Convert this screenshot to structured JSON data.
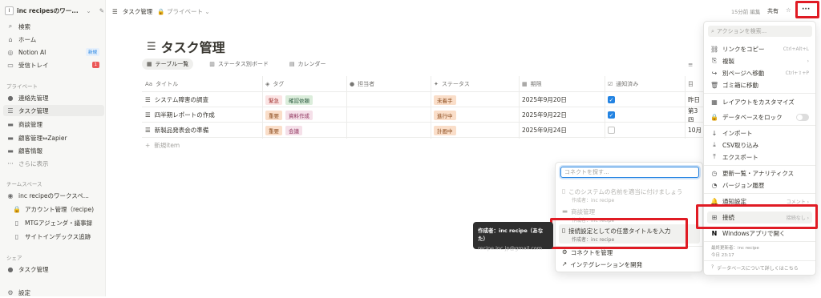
{
  "sidebar": {
    "workspace": "inc recipesのワー...",
    "top_items": [
      {
        "icon": "⌕",
        "label": "検索"
      },
      {
        "icon": "⌂",
        "label": "ホーム"
      },
      {
        "icon": "◎",
        "label": "Notion AI",
        "badge": "新規"
      },
      {
        "icon": "▭",
        "label": "受信トレイ",
        "badge": "1"
      }
    ],
    "private_label": "プライベート",
    "private_items": [
      {
        "label": "連絡先管理"
      },
      {
        "label": "タスク管理"
      },
      {
        "label": "商談管理"
      },
      {
        "label": "顧客管理⇔Zapier"
      },
      {
        "label": "顧客情報"
      },
      {
        "label": "さらに表示"
      }
    ],
    "team_label": "チームスペース",
    "team_items": [
      {
        "label": "inc recipeのワークスペ..."
      },
      {
        "label": "アカウント管理（recipe)"
      },
      {
        "label": "MTGアジェンダ・議事録"
      },
      {
        "label": "サイトインデックス追跡"
      }
    ],
    "share_label": "シェア",
    "share_items": [
      {
        "label": "タスク管理"
      }
    ],
    "settings": "設定"
  },
  "topbar": {
    "breadcrumb": "タスク管理",
    "privacy": "プライベート",
    "edited": "15分前 編集",
    "share": "共有",
    "more": "···"
  },
  "page": {
    "title": "タスク管理",
    "tabs": [
      "テーブル一覧",
      "ステータス別ボード",
      "カレンダー"
    ],
    "columns": [
      "タイトル",
      "タグ",
      "担当者",
      "ステータス",
      "期限",
      "通知済み",
      "目"
    ],
    "rows": [
      {
        "title": "システム障害の調査",
        "tags": [
          "緊急",
          "確認依頼"
        ],
        "status": "未着手",
        "due": "2025年9月20日",
        "done": true,
        "last": "昨日"
      },
      {
        "title": "四半期レポートの作成",
        "tags": [
          "重要",
          "資料作成"
        ],
        "status": "進行中",
        "due": "2025年9月22日",
        "done": true,
        "last": "第3四"
      },
      {
        "title": "新製品発表会の準備",
        "tags": [
          "重要",
          "会議"
        ],
        "status": "計画中",
        "due": "2025年9月24日",
        "done": false,
        "last": "10月"
      }
    ],
    "new_item": "新規item"
  },
  "menu": {
    "search_placeholder": "アクションを検索...",
    "items": [
      {
        "icon": "⛓",
        "label": "リンクをコピー",
        "sc": "Ctrl+Alt+L"
      },
      {
        "icon": "⎘",
        "label": "複製",
        "sc": "›"
      },
      {
        "icon": "↪",
        "label": "別ページへ移動",
        "sc": "Ctrl+⇧+P"
      },
      {
        "icon": "🗑",
        "label": "ゴミ箱に移動",
        "sc": ""
      },
      {
        "icon": "▦",
        "label": "レイアウトをカスタマイズ",
        "sc": ""
      },
      {
        "icon": "🔒",
        "label": "データベースをロック",
        "sc": ""
      },
      {
        "icon": "↓",
        "label": "インポート",
        "sc": ""
      },
      {
        "icon": "⤓",
        "label": "CSV取り込み",
        "sc": ""
      },
      {
        "icon": "⤒",
        "label": "エクスポート",
        "sc": ""
      },
      {
        "icon": "◷",
        "label": "更新一覧・アナリティクス",
        "sc": ""
      },
      {
        "icon": "◔",
        "label": "バージョン履歴",
        "sc": ""
      },
      {
        "icon": "🔔",
        "label": "通知設定",
        "sc": "コメント ›"
      },
      {
        "icon": "⊞",
        "label": "接続",
        "sc": "接続なし ›"
      },
      {
        "icon": "N",
        "label": "Windowsアプリで開く",
        "sc": ""
      }
    ],
    "footer_1": "最終更新者：inc recipe",
    "footer_2": "今日 23:17",
    "footer_3": "データベースについて詳しくはこちら"
  },
  "connect": {
    "placeholder": "コネクトを探す...",
    "items": [
      {
        "label": "このシステムの名前を適当に付けましょう",
        "sub": "作成者：inc recipe"
      },
      {
        "label": "商談管理",
        "sub": "作成者：inc recipe"
      },
      {
        "label": "接続設定としての任意タイトルを入力",
        "sub": "作成者：inc recipe"
      },
      {
        "label": "コネクトを管理",
        "sub": ""
      },
      {
        "label": "インテグレーションを開発",
        "sub": ""
      }
    ]
  },
  "tooltip": {
    "line1": "作成者：inc recipe（あなた）",
    "line2": "recipe.inc.jp@gmail.com"
  },
  "colors": {
    "accent": "#2383e2",
    "highlight": "#e01b24"
  }
}
